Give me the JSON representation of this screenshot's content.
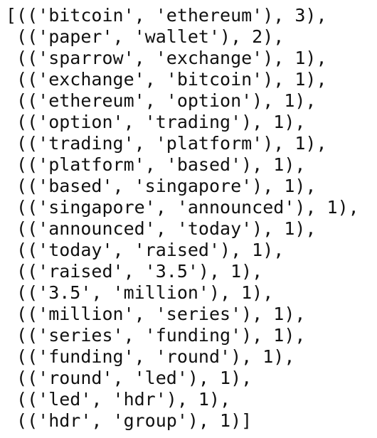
{
  "output": {
    "lines": [
      "[(('bitcoin', 'ethereum'), 3),",
      " (('paper', 'wallet'), 2),",
      " (('sparrow', 'exchange'), 1),",
      " (('exchange', 'bitcoin'), 1),",
      " (('ethereum', 'option'), 1),",
      " (('option', 'trading'), 1),",
      " (('trading', 'platform'), 1),",
      " (('platform', 'based'), 1),",
      " (('based', 'singapore'), 1),",
      " (('singapore', 'announced'), 1),",
      " (('announced', 'today'), 1),",
      " (('today', 'raised'), 1),",
      " (('raised', '3.5'), 1),",
      " (('3.5', 'million'), 1),",
      " (('million', 'series'), 1),",
      " (('series', 'funding'), 1),",
      " (('funding', 'round'), 1),",
      " (('round', 'led'), 1),",
      " (('led', 'hdr'), 1),",
      " (('hdr', 'group'), 1)]"
    ]
  }
}
